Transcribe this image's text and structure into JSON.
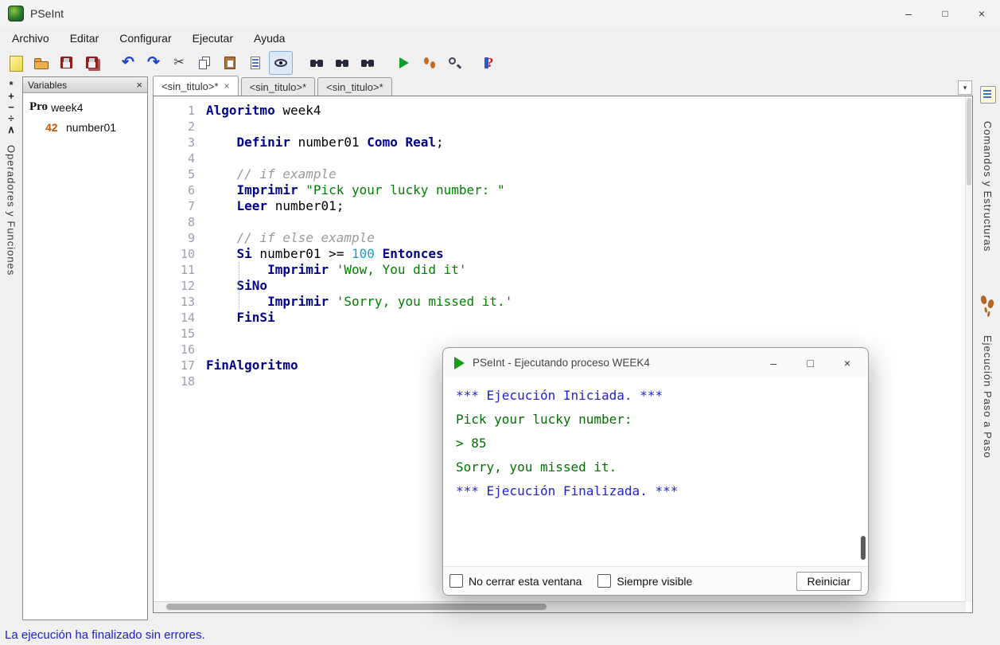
{
  "glyphs": {
    "minimize": "–",
    "maximize": "□",
    "close": "×",
    "close_small": "×",
    "dropdown": "▾"
  },
  "window": {
    "title": "PSeInt"
  },
  "menu": {
    "items": [
      "Archivo",
      "Editar",
      "Configurar",
      "Ejecutar",
      "Ayuda"
    ]
  },
  "toolbar": {
    "buttons": [
      {
        "name": "new",
        "icon": "new"
      },
      {
        "name": "open",
        "icon": "open"
      },
      {
        "name": "save",
        "icon": "save"
      },
      {
        "name": "save-all",
        "icon": "save-all",
        "sep_after": true
      },
      {
        "name": "undo",
        "icon": "undo"
      },
      {
        "name": "redo",
        "icon": "redo"
      },
      {
        "name": "cut",
        "icon": "cut"
      },
      {
        "name": "copy",
        "icon": "copy"
      },
      {
        "name": "paste",
        "icon": "paste"
      },
      {
        "name": "format",
        "icon": "format"
      },
      {
        "name": "syntax-view",
        "icon": "eye",
        "active": true,
        "sep_after": true
      },
      {
        "name": "find",
        "icon": "find"
      },
      {
        "name": "find-next",
        "icon": "find-next"
      },
      {
        "name": "replace",
        "icon": "replace",
        "sep_after": true
      },
      {
        "name": "run",
        "icon": "run"
      },
      {
        "name": "step-run",
        "icon": "step"
      },
      {
        "name": "debug",
        "icon": "debug",
        "sep_after": true
      },
      {
        "name": "help",
        "icon": "help"
      }
    ]
  },
  "left_strip": {
    "symbols": [
      "*",
      "+",
      "−",
      "÷",
      "∧"
    ],
    "label": "Operadores y Funciones"
  },
  "variables_panel": {
    "title": "Variables",
    "items": [
      {
        "type": "process",
        "badge": "Pro",
        "label": "week4",
        "indent": 0
      },
      {
        "type": "real",
        "badge": "42",
        "label": "number01",
        "indent": 1
      }
    ]
  },
  "tabs": {
    "items": [
      {
        "label": "<sin_titulo>*",
        "active": true
      },
      {
        "label": "<sin_titulo>*",
        "active": false
      },
      {
        "label": "<sin_titulo>*",
        "active": false
      }
    ]
  },
  "editor": {
    "lines": [
      {
        "n": 1,
        "s": [
          {
            "t": "kw",
            "v": "Algoritmo"
          },
          {
            "t": "pl",
            "v": " week4"
          }
        ]
      },
      {
        "n": 2,
        "s": []
      },
      {
        "n": 3,
        "s": [
          {
            "t": "pl",
            "v": "    "
          },
          {
            "t": "kw",
            "v": "Definir"
          },
          {
            "t": "pl",
            "v": " number01 "
          },
          {
            "t": "kw",
            "v": "Como"
          },
          {
            "t": "pl",
            "v": " "
          },
          {
            "t": "kw",
            "v": "Real"
          },
          {
            "t": "pl",
            "v": ";"
          }
        ]
      },
      {
        "n": 4,
        "s": []
      },
      {
        "n": 5,
        "s": [
          {
            "t": "pl",
            "v": "    "
          },
          {
            "t": "com",
            "v": "// if example"
          }
        ]
      },
      {
        "n": 6,
        "s": [
          {
            "t": "pl",
            "v": "    "
          },
          {
            "t": "kw",
            "v": "Imprimir"
          },
          {
            "t": "pl",
            "v": " "
          },
          {
            "t": "str",
            "v": "\"Pick your lucky number: \""
          }
        ]
      },
      {
        "n": 7,
        "s": [
          {
            "t": "pl",
            "v": "    "
          },
          {
            "t": "kw",
            "v": "Leer"
          },
          {
            "t": "pl",
            "v": " number01;"
          }
        ]
      },
      {
        "n": 8,
        "s": []
      },
      {
        "n": 9,
        "s": [
          {
            "t": "pl",
            "v": "    "
          },
          {
            "t": "com",
            "v": "// if else example"
          }
        ]
      },
      {
        "n": 10,
        "s": [
          {
            "t": "pl",
            "v": "    "
          },
          {
            "t": "kw",
            "v": "Si"
          },
          {
            "t": "pl",
            "v": " number01 >= "
          },
          {
            "t": "num",
            "v": "100"
          },
          {
            "t": "pl",
            "v": " "
          },
          {
            "t": "kw",
            "v": "Entonces"
          }
        ]
      },
      {
        "n": 11,
        "s": [
          {
            "t": "pl",
            "v": "        "
          },
          {
            "t": "kw",
            "v": "Imprimir"
          },
          {
            "t": "pl",
            "v": " "
          },
          {
            "t": "str",
            "v": "'Wow, You did it'"
          }
        ]
      },
      {
        "n": 12,
        "s": [
          {
            "t": "pl",
            "v": "    "
          },
          {
            "t": "kw",
            "v": "SiNo"
          }
        ]
      },
      {
        "n": 13,
        "s": [
          {
            "t": "pl",
            "v": "        "
          },
          {
            "t": "kw",
            "v": "Imprimir"
          },
          {
            "t": "pl",
            "v": " "
          },
          {
            "t": "str",
            "v": "'Sorry, you missed it.'"
          }
        ]
      },
      {
        "n": 14,
        "s": [
          {
            "t": "pl",
            "v": "    "
          },
          {
            "t": "kw",
            "v": "FinSi"
          }
        ]
      },
      {
        "n": 15,
        "s": []
      },
      {
        "n": 16,
        "s": []
      },
      {
        "n": 17,
        "s": [
          {
            "t": "kw",
            "v": "FinAlgoritmo"
          }
        ]
      },
      {
        "n": 18,
        "s": []
      }
    ]
  },
  "right_strips": {
    "commands": {
      "label": "Comandos y Estructuras"
    },
    "step": {
      "label": "Ejecución Paso a Paso"
    }
  },
  "exec_window": {
    "title": "PSeInt - Ejecutando proceso WEEK4",
    "output": [
      {
        "color": "blue",
        "text": "*** Ejecución Iniciada. ***"
      },
      {
        "color": "green",
        "text": "Pick your lucky number: "
      },
      {
        "color": "green",
        "text": "> 85"
      },
      {
        "color": "green",
        "text": "Sorry, you missed it."
      },
      {
        "color": "blue",
        "text": "*** Ejecución Finalizada. ***"
      }
    ],
    "options": [
      {
        "label": "No cerrar esta ventana",
        "checked": false
      },
      {
        "label": "Siempre visible",
        "checked": false
      }
    ],
    "restart_label": "Reiniciar"
  },
  "status_bar": {
    "text": "La ejecución ha finalizado sin errores."
  },
  "colors": {
    "keyword": "#00008b",
    "string": "#008000",
    "comment": "#9a9a9a",
    "number": "#18a0c8",
    "exec_info": "#2323cd",
    "exec_output": "#007000",
    "status_text": "#2020cc"
  }
}
